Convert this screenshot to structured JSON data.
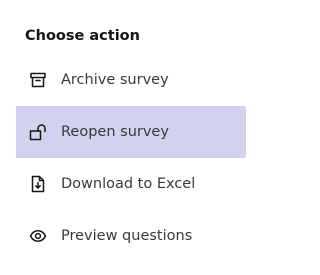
{
  "menu": {
    "title": "Choose action",
    "selected_index": 1,
    "items": [
      {
        "label": "Archive survey",
        "icon": "archive-icon"
      },
      {
        "label": "Reopen survey",
        "icon": "unlock-icon"
      },
      {
        "label": "Download to Excel",
        "icon": "document-download-icon"
      },
      {
        "label": "Preview questions",
        "icon": "eye-icon"
      }
    ]
  },
  "colors": {
    "selected_background": "#d0d2ef",
    "text": "#393939",
    "title": "#161616",
    "icon": "#161616"
  }
}
